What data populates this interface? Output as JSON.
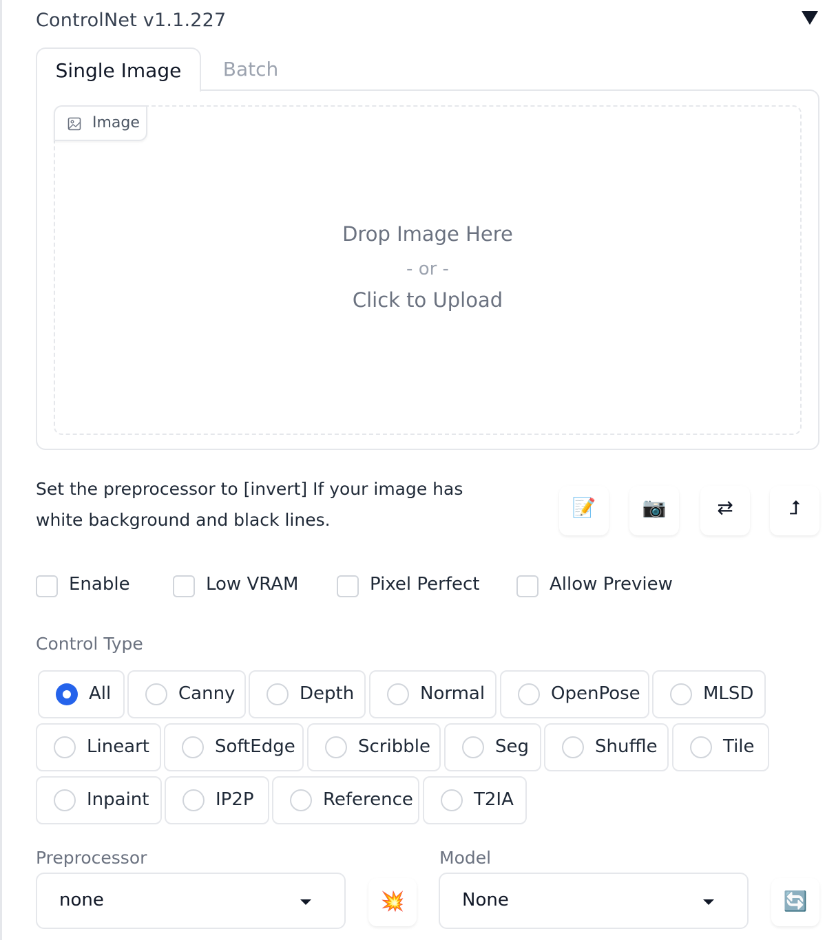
{
  "header": {
    "title": "ControlNet v1.1.227"
  },
  "tabs": [
    {
      "label": "Single Image",
      "active": true
    },
    {
      "label": "Batch",
      "active": false
    }
  ],
  "upload": {
    "label": "Image",
    "line1": "Drop Image Here",
    "line2": "- or -",
    "line3": "Click to Upload"
  },
  "hint": "Set the preprocessor to [invert] If your image has white background and black lines.",
  "tools": [
    {
      "icon": "memo-pencil-icon",
      "glyph": "📝"
    },
    {
      "icon": "camera-icon",
      "glyph": "📷"
    },
    {
      "icon": "swap-arrows-icon",
      "glyph": "⇄"
    },
    {
      "icon": "upload-arrow-icon",
      "glyph": "⮥"
    }
  ],
  "checkboxes": [
    {
      "label": "Enable",
      "checked": false
    },
    {
      "label": "Low VRAM",
      "checked": false
    },
    {
      "label": "Pixel Perfect",
      "checked": false
    },
    {
      "label": "Allow Preview",
      "checked": false
    }
  ],
  "control_type": {
    "label": "Control Type",
    "selected": "All",
    "options": [
      "All",
      "Canny",
      "Depth",
      "Normal",
      "OpenPose",
      "MLSD",
      "Lineart",
      "SoftEdge",
      "Scribble",
      "Seg",
      "Shuffle",
      "Tile",
      "Inpaint",
      "IP2P",
      "Reference",
      "T2IA"
    ]
  },
  "preprocessor": {
    "label": "Preprocessor",
    "value": "none",
    "button_icon": "collision-icon",
    "button_glyph": "💥"
  },
  "model": {
    "label": "Model",
    "value": "None",
    "button_icon": "refresh-icon",
    "button_glyph": "🔄"
  },
  "colors": {
    "accent": "#2563eb",
    "border": "#e5e7eb"
  }
}
